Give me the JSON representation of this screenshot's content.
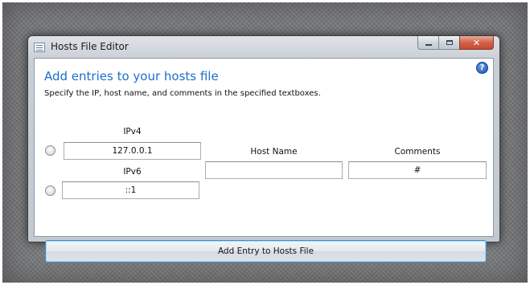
{
  "window": {
    "title": "Hosts File Editor",
    "app_icon": "list-document-icon",
    "caption_buttons": {
      "minimize": "minimize-icon",
      "maximize": "maximize-icon",
      "close": "close-icon"
    }
  },
  "content": {
    "heading": "Add entries to your hosts file",
    "subheading": "Specify the IP, host name, and comments in the specified textboxes.",
    "help_icon": "?",
    "ipv4": {
      "label": "IPv4",
      "value": "127.0.0.1",
      "selected": false
    },
    "ipv6": {
      "label": "IPv6",
      "value": "::1",
      "selected": false
    },
    "hostname": {
      "label": "Host Name",
      "value": ""
    },
    "comments": {
      "label": "Comments",
      "value": "#"
    },
    "add_button_label": "Add Entry to Hosts File"
  },
  "colors": {
    "heading": "#1c6fcd",
    "close_button": "#c44a31",
    "button_focus_border": "#3c8fc8"
  }
}
